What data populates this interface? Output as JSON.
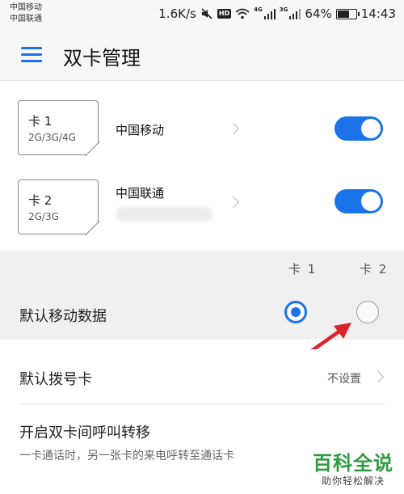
{
  "status_bar": {
    "carrier_1": "中国移动",
    "carrier_2": "中国联通",
    "speed": "1.6K/s",
    "hd_badge": "HD",
    "sim1_network": "4G",
    "sim2_network": "3G",
    "battery": "64%",
    "battery_level": 0.64,
    "time": "14:43",
    "icons": [
      "mute-icon",
      "wifi-icon",
      "signal-icon",
      "battery-icon"
    ]
  },
  "app_bar": {
    "title": "双卡管理",
    "menu_icon": "menu-icon"
  },
  "sims": [
    {
      "card_name": "卡 1",
      "networks": "2G/3G/4G",
      "carrier": "中国移动",
      "enabled": true
    },
    {
      "card_name": "卡 2",
      "networks": "2G/3G",
      "carrier": "中国联通",
      "enabled": true
    }
  ],
  "default_data": {
    "col_1": "卡 1",
    "col_2": "卡 2",
    "label": "默认移动数据",
    "selected": "卡 1"
  },
  "default_dial": {
    "label": "默认拨号卡",
    "value": "不设置"
  },
  "call_forwarding": {
    "title": "开启双卡间呼叫转移",
    "description": "一卡通话时，另一张卡的来电呼转至通话卡"
  },
  "watermark": {
    "title": "百科全说",
    "subtitle": "助你轻松解决"
  },
  "colors": {
    "accent": "#1a73e8",
    "annotation_arrow": "#d9232b",
    "watermark": "#2e9b3e"
  }
}
